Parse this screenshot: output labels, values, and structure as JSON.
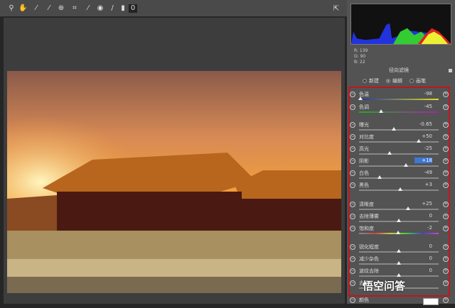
{
  "toolbar": {
    "tools": [
      "zoom-icon",
      "hand-icon",
      "white-balance-icon",
      "color-sampler-icon",
      "target-adjust-icon",
      "crop-icon",
      "spot-removal-icon",
      "red-eye-icon",
      "adjustment-brush-icon",
      "graduated-filter-icon",
      "radial-filter-icon"
    ]
  },
  "readout": {
    "r": "R: 139",
    "g": "G: 90",
    "b": "B: 22"
  },
  "panel": {
    "title": "径向滤镜",
    "modes": [
      "新建",
      "编辑",
      "画笔"
    ],
    "selected_mode": "编辑"
  },
  "sliders": [
    {
      "label": "色温",
      "value": "-98",
      "pos": 0.02,
      "track": "linear-gradient(90deg,#2233aa,#dddd22)"
    },
    {
      "label": "色调",
      "value": "-45",
      "pos": 0.28,
      "track": "linear-gradient(90deg,#22aa22,#aa22aa)"
    },
    {
      "label": "曝光",
      "value": "-0.65",
      "pos": 0.44,
      "track": "#888"
    },
    {
      "label": "对比度",
      "value": "+50",
      "pos": 0.75,
      "track": "#888"
    },
    {
      "label": "高光",
      "value": "-25",
      "pos": 0.38,
      "track": "#888"
    },
    {
      "label": "阴影",
      "value": "+18",
      "pos": 0.59,
      "track": "#888",
      "selected": true
    },
    {
      "label": "白色",
      "value": "-49",
      "pos": 0.26,
      "track": "#888"
    },
    {
      "label": "黑色",
      "value": "+3",
      "pos": 0.52,
      "track": "#888"
    },
    {
      "label": "清晰度",
      "value": "+25",
      "pos": 0.62,
      "track": "#888"
    },
    {
      "label": "去除薄雾",
      "value": "0",
      "pos": 0.5,
      "track": "#888"
    },
    {
      "label": "饱和度",
      "value": "-2",
      "pos": 0.49,
      "track": "linear-gradient(90deg,#888,#c44,#cc4,#4c4,#44c,#c4c)"
    },
    {
      "label": "锐化程度",
      "value": "0",
      "pos": 0.5,
      "track": "#888"
    },
    {
      "label": "减少杂色",
      "value": "0",
      "pos": 0.5,
      "track": "#888"
    },
    {
      "label": "波纹去除",
      "value": "0",
      "pos": 0.5,
      "track": "#888"
    },
    {
      "label": "去边",
      "value": "",
      "pos": 0.5,
      "track": "#888"
    }
  ],
  "color_row": {
    "label": "颜色"
  },
  "watermark": "悟空问答"
}
